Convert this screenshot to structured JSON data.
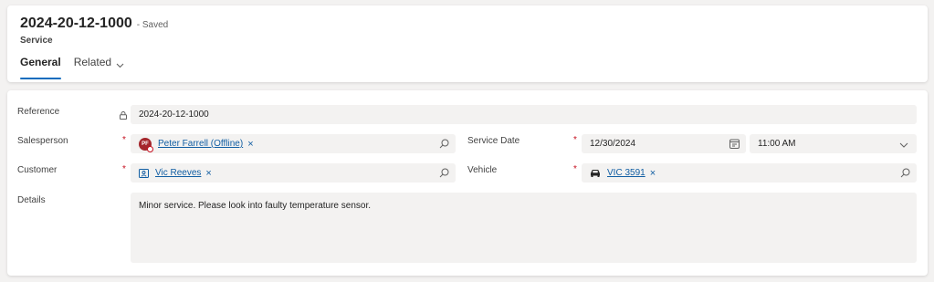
{
  "record": {
    "title": "2024-20-12-1000",
    "status": "- Saved",
    "entity": "Service"
  },
  "tabs": [
    {
      "label": "General",
      "active": true
    },
    {
      "label": "Related",
      "active": false
    }
  ],
  "form": {
    "reference": {
      "label": "Reference",
      "value": "2024-20-12-1000"
    },
    "salesperson": {
      "label": "Salesperson",
      "required": "*",
      "avatar_initials": "PF",
      "value": "Peter Farrell (Offline)",
      "remove": "×"
    },
    "customer": {
      "label": "Customer",
      "required": "*",
      "value": "Vic Reeves",
      "remove": "×"
    },
    "details": {
      "label": "Details",
      "value": "Minor service. Please look into faulty temperature sensor."
    },
    "service_date": {
      "label": "Service Date",
      "required": "*",
      "date": "12/30/2024",
      "time": "11:00 AM"
    },
    "vehicle": {
      "label": "Vehicle",
      "required": "*",
      "value": "VIC 3591",
      "remove": "×"
    }
  },
  "icons": {
    "lock": "lock-icon",
    "search": "search-icon",
    "calendar": "calendar-icon",
    "chevron": "chevron-down-icon",
    "contact": "contact-card-icon",
    "car": "car-icon"
  },
  "colors": {
    "accent": "#0f6cbd",
    "link": "#115ea3",
    "required": "#c50f1f",
    "avatar": "#a4262c",
    "field_bg": "#f3f2f1"
  }
}
